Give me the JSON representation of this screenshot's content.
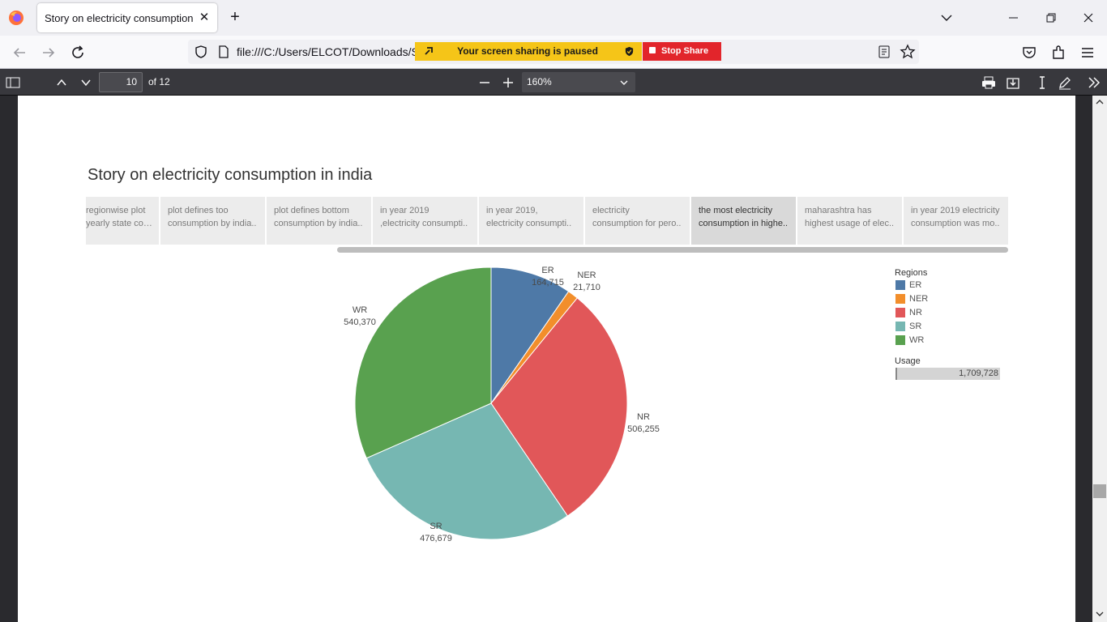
{
  "browser": {
    "tab_title": "Story on electricity consumption in india",
    "tab_close": "✕",
    "new_tab": "+",
    "url": "file:///C:/Users/ELCOT/Downloads/St",
    "share_banner_text": "Your screen sharing is paused",
    "stop_share_label": "Stop Share"
  },
  "pdf_toolbar": {
    "page_number": "10",
    "page_count": "of 12",
    "zoom": "160%"
  },
  "story": {
    "title": "Story on electricity consumption in india",
    "points": [
      {
        "line1": "regionwise plot",
        "line2": "yearly state con.."
      },
      {
        "line1": "plot defines too",
        "line2": "consumption by india.."
      },
      {
        "line1": "plot defines bottom",
        "line2": "consumption by india.."
      },
      {
        "line1": "in year 2019",
        "line2": ",electricity consumpti.."
      },
      {
        "line1": "in year 2019,",
        "line2": "electricity consumpti.."
      },
      {
        "line1": "electricity",
        "line2": "consumption for pero.."
      },
      {
        "line1": "the most electricity",
        "line2": "consumption in highe..",
        "active": true
      },
      {
        "line1": "maharashtra has",
        "line2": "highest usage of elec.."
      },
      {
        "line1": "in year 2019 electricity",
        "line2": "consumption was mo.."
      }
    ]
  },
  "legend": {
    "title": "Regions",
    "items": [
      {
        "label": "ER",
        "color": "#4e79a7"
      },
      {
        "label": "NER",
        "color": "#f28e2b"
      },
      {
        "label": "NR",
        "color": "#e15759"
      },
      {
        "label": "SR",
        "color": "#76b7b2"
      },
      {
        "label": "WR",
        "color": "#59a14f"
      }
    ],
    "usage_title": "Usage",
    "usage_value": "1,709,728"
  },
  "chart_data": {
    "type": "pie",
    "categories": [
      "ER",
      "NER",
      "NR",
      "SR",
      "WR"
    ],
    "values": [
      164715,
      21710,
      506255,
      476679,
      540370
    ],
    "value_labels": [
      "164,715",
      "21,710",
      "506,255",
      "476,679",
      "540,370"
    ],
    "colors": [
      "#4e79a7",
      "#f28e2b",
      "#e15759",
      "#76b7b2",
      "#59a14f"
    ],
    "legend": "right"
  }
}
